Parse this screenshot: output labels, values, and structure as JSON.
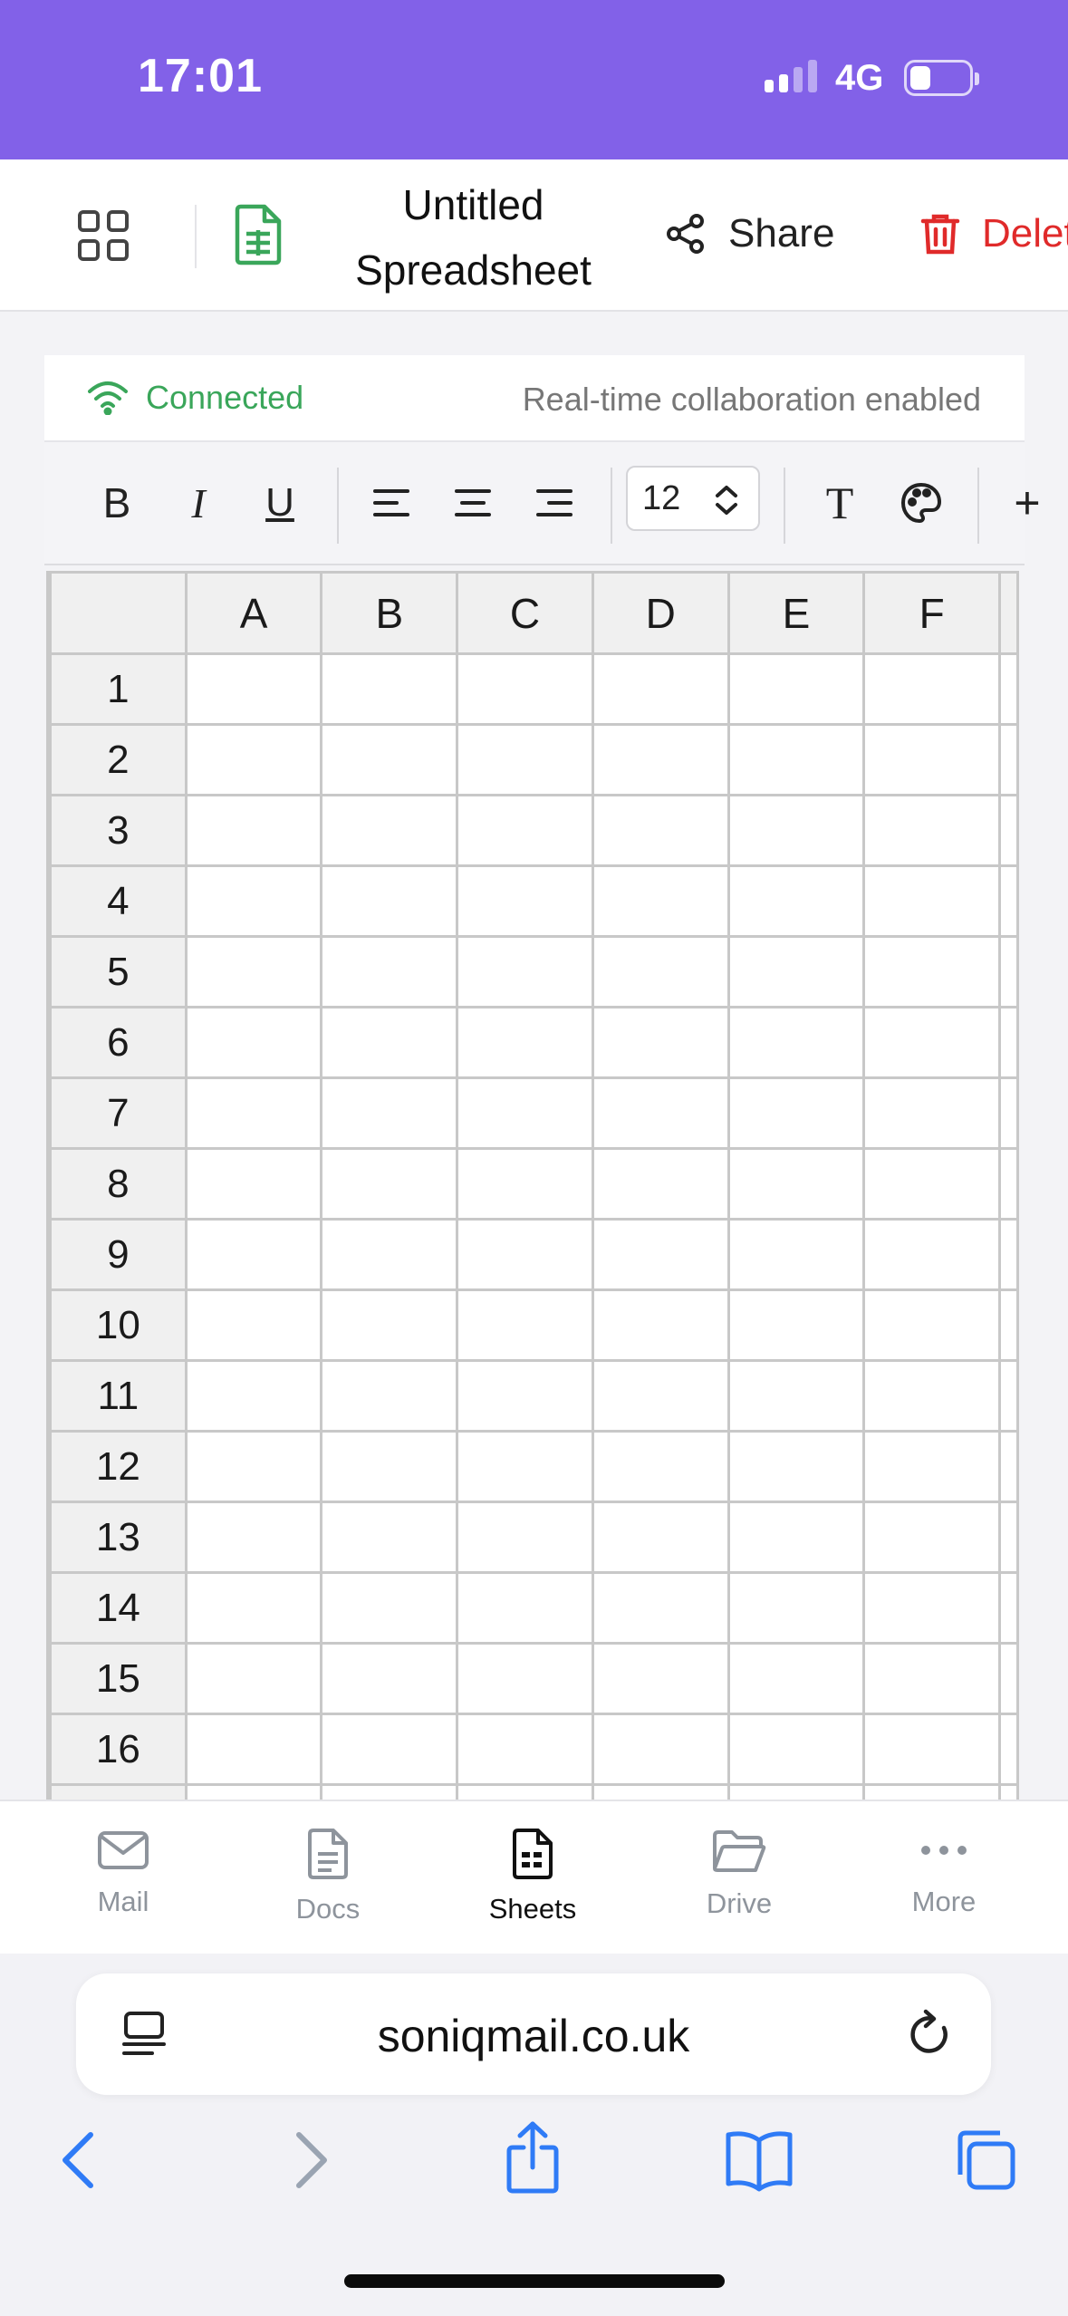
{
  "status_bar": {
    "time": "17:01",
    "network": "4G"
  },
  "header": {
    "title": "Untitled Spreadsheet",
    "share_label": "Share",
    "delete_label": "Delete",
    "icons": [
      "grid-menu-icon",
      "sheet-file-icon",
      "share-icon",
      "trash-icon"
    ],
    "colors": {
      "accent_green": "#3aa65a",
      "delete_red": "#e02a2a",
      "status_bar": "#8261e8"
    }
  },
  "connection": {
    "status": "Connected",
    "note": "Real-time collaboration enabled"
  },
  "toolbar": {
    "bold": "B",
    "italic": "I",
    "underline": "U",
    "font_size": "12",
    "text_tool": "T",
    "add": "+"
  },
  "sheet": {
    "columns": [
      "A",
      "B",
      "C",
      "D",
      "E",
      "F"
    ],
    "rows": [
      "1",
      "2",
      "3",
      "4",
      "5",
      "6",
      "7",
      "8",
      "9",
      "10",
      "11",
      "12",
      "13",
      "14",
      "15",
      "16"
    ]
  },
  "bottom_nav": {
    "items": [
      {
        "label": "Mail",
        "icon": "mail-icon"
      },
      {
        "label": "Docs",
        "icon": "docs-icon"
      },
      {
        "label": "Sheets",
        "icon": "sheets-icon",
        "active": true
      },
      {
        "label": "Drive",
        "icon": "folder-icon"
      },
      {
        "label": "More",
        "icon": "more-icon"
      }
    ]
  },
  "browser": {
    "url": "soniqmail.co.uk"
  }
}
